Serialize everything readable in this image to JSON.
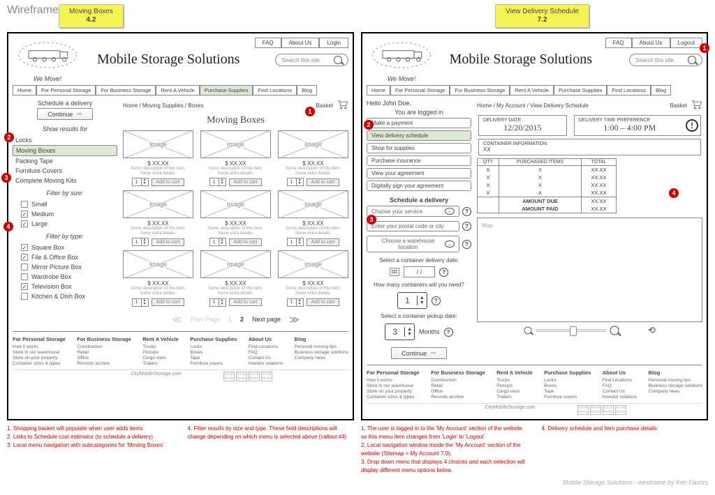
{
  "page": {
    "wfTitle": "Wireframes",
    "credit": "Mobile Storage Solutions - wireframe by Ken Favors"
  },
  "shared": {
    "siteTitle": "Mobile Storage Solutions",
    "slogan": "We Move!",
    "searchPlaceholder": "Search this site",
    "nav": [
      "Home",
      "For Personal Storage",
      "For Business Storage",
      "Rent A Vehicle",
      "Purchase Supplies",
      "Find Locations",
      "Blog"
    ],
    "basket": "Basket",
    "scheduleDelivery": "Schedule a delivery",
    "continueBtn": "Continue",
    "imagePlaceholder": "Image",
    "productPrice": "$ XX.XX",
    "productDesc1": "Some description of this item.",
    "productDesc2": "Some extra details.",
    "stepperDefault": "1",
    "addToCart": "Add to cart",
    "pager": {
      "prev": "Prev Page",
      "one": "1",
      "two": "2",
      "next": "Next page"
    },
    "footer": {
      "domain": "CityMobileStorage.com",
      "cols": [
        {
          "h": "For Personal Storage",
          "items": [
            "How it works",
            "Store in our warehouse",
            "Store on your property",
            "Container sizes & types"
          ]
        },
        {
          "h": "For Business Storage",
          "items": [
            "Construction",
            "Retail",
            "Office",
            "Records archive"
          ]
        },
        {
          "h": "Rent A Vehicle",
          "items": [
            "Trucks",
            "Pickups",
            "Cargo vans",
            "Trailers"
          ]
        },
        {
          "h": "Purchase Supplies",
          "items": [
            "Locks",
            "Boxes",
            "Tape",
            "Furniture covers"
          ]
        },
        {
          "h": "About Us",
          "items": [
            "Find Locations",
            "FAQ",
            "Contact Us",
            "Investor relations"
          ]
        },
        {
          "h": "Blog",
          "items": [
            "Personal moving tips",
            "Business storage solutions",
            "Company news"
          ]
        }
      ],
      "social": [
        "Social Media",
        "Social Media",
        "Social Media",
        "Social Media"
      ]
    }
  },
  "left": {
    "sticky": {
      "title": "Moving Boxes",
      "ver": "4.2"
    },
    "util": [
      "FAQ",
      "About Us",
      "Login"
    ],
    "activeNav": 4,
    "breadcrumb": "Home / Moving Supplies / Boxes",
    "heading": "Moving Boxes",
    "sideHead1": "Show results for",
    "cats": [
      "Locks",
      "Moving Boxes",
      "Packing Tape",
      "Furniture Covers",
      "Complete Moving Kits"
    ],
    "catSelected": 1,
    "sideHead2": "Filter by size:",
    "sizes": [
      {
        "l": "Small",
        "c": false
      },
      {
        "l": "Medium",
        "c": true
      },
      {
        "l": "Large",
        "c": true
      }
    ],
    "sideHead3": "Filter by type:",
    "types": [
      {
        "l": "Square Box",
        "c": true
      },
      {
        "l": "File & Office Box",
        "c": true
      },
      {
        "l": "Mirror Picture Box",
        "c": false
      },
      {
        "l": "Wardrobe Box",
        "c": false
      },
      {
        "l": "Television Box",
        "c": true
      },
      {
        "l": "Kitchen & Dish Box",
        "c": false
      }
    ],
    "annotations": [
      "1. Shopping basket will populate when user adds items",
      "2. Links to Schedule cost estimator (to schedule a delivery)",
      "3. Local menu navigation with subcategories for 'Moving Boxes'",
      "4. Filter results by size and type. These field descriptions will change depending on which menu is selected above (callout #4)"
    ]
  },
  "right": {
    "sticky": {
      "title": "View Delivery Schedule",
      "ver": "7.2"
    },
    "util": [
      "FAQ",
      "About Us",
      "Logout"
    ],
    "activeNav": -1,
    "greeting": "Hello John Doe,",
    "loggedIn": "You are logged in",
    "menu": [
      "Make a payment",
      "View delivery schedule",
      "Shop for supplies",
      "Purchase insurance",
      "View your agreement",
      "Digitally sign your agreement"
    ],
    "menuSelected": 1,
    "sched": {
      "head": "Schedule a delivery",
      "service": "Choose your service",
      "postal": "Enter your postal code or city",
      "warehouse": "Choose a warehouse location",
      "dateLabel": "Select a container delivery date:",
      "dateVal": "/        /",
      "howMany": "How many containers will you need?",
      "howManyVal": "1",
      "pickupLabel": "Select a container pickup date:",
      "pickupVal": "3",
      "months": "Months"
    },
    "breadcrumb": "Home / My Account / View Delivery Schedule",
    "delivery": {
      "dateLbl": "DELIVERY DATE",
      "date": "12/20/2015",
      "timeLbl": "DELIVERY TIME PREFERENCE",
      "time": "1:00 – 4:00 PM",
      "containerLbl": "CONTAINER INFORMATION",
      "container": "XX",
      "cols": [
        "QTY",
        "PURCHASED ITEMS",
        "TOTAL"
      ],
      "rows": [
        [
          "X",
          "X",
          "XX.XX"
        ],
        [
          "X",
          "X",
          "XX.XX"
        ],
        [
          "X",
          "X",
          "XX.XX"
        ],
        [
          "X",
          "X",
          "XX.XX"
        ]
      ],
      "due": "AMOUNT DUE",
      "dueVal": "XX.XX",
      "paid": "AMOUNT PAID",
      "paidVal": "XX.XX"
    },
    "map": "Map",
    "annotations": [
      "1. The user is logged in to the 'My Account' section of the website so this menu item changes from 'Login' to 'Logout'",
      "2. Local navigation window inside the 'My Account' section of the website (Sitemap > My Account 7.0).",
      "3. Drop down menu that displays 4 choices and each selection will display different menu options below.",
      "4. Delivery schedule and item purchase details"
    ]
  }
}
